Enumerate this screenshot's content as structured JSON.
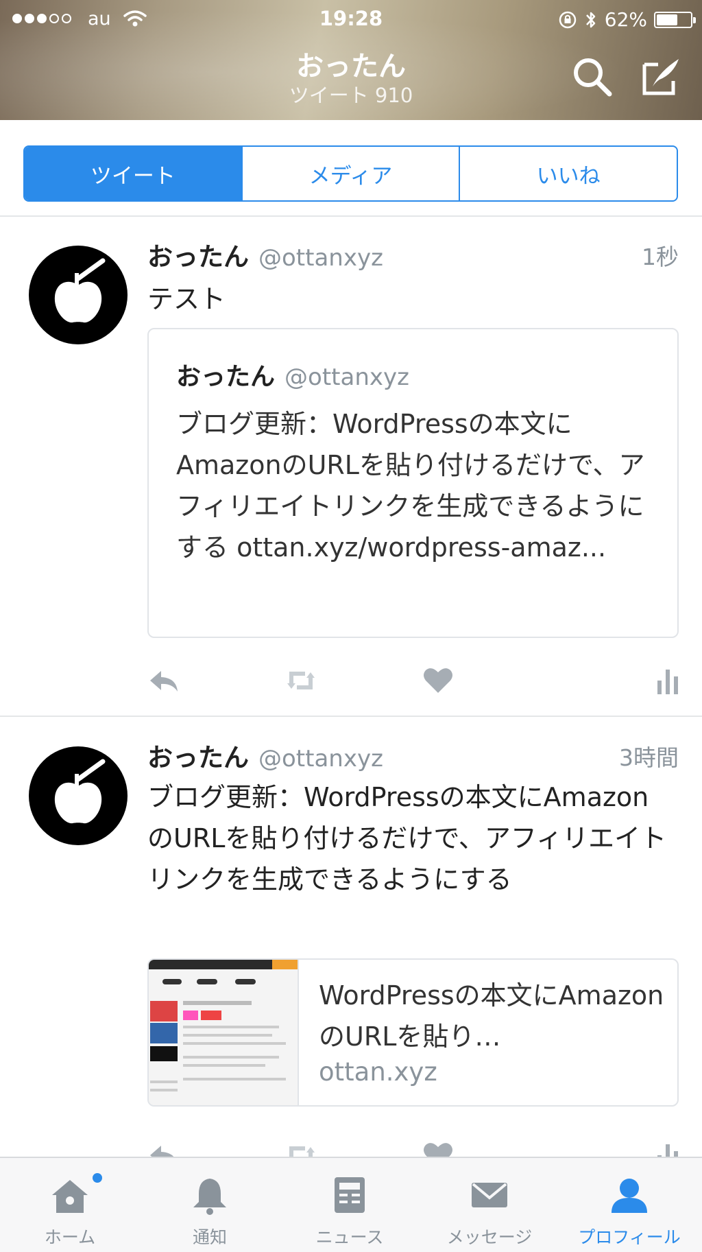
{
  "status_bar": {
    "carrier": "au",
    "time": "19:28",
    "battery": "62%",
    "battery_level": 0.62
  },
  "header": {
    "title": "おったん",
    "subtitle": "ツイート 910",
    "search_icon": "search-icon",
    "compose_icon": "compose-icon"
  },
  "tabs": [
    "ツイート",
    "メディア",
    "いいね"
  ],
  "tweets": [
    {
      "name": "おったん",
      "handle": "@ottanxyz",
      "time": "1秒",
      "text": "テスト",
      "quote": {
        "name": "おったん",
        "handle": "@ottanxyz",
        "text": "ブログ更新：WordPressの本文にAmazonのURLを貼り付けるだけで、アフィリエイトリンクを生成できるようにする ottan.xyz/wordpress-amaz..."
      }
    },
    {
      "name": "おったん",
      "handle": "@ottanxyz",
      "time": "3時間",
      "text": "ブログ更新：WordPressの本文にAmazonのURLを貼り付けるだけで、アフィリエイトリンクを生成できるようにする",
      "card": {
        "title": "WordPressの本文にAmazonのURLを貼り…",
        "domain": "ottan.xyz"
      }
    }
  ],
  "tabbar": [
    {
      "label": "ホーム",
      "icon": "home-icon"
    },
    {
      "label": "通知",
      "icon": "bell-icon"
    },
    {
      "label": "ニュース",
      "icon": "news-icon"
    },
    {
      "label": "メッセージ",
      "icon": "message-icon"
    },
    {
      "label": "プロフィール",
      "icon": "profile-icon"
    }
  ],
  "colors": {
    "accent": "#2b8bea",
    "muted": "#8a939b",
    "divider": "#e4e6e8"
  }
}
